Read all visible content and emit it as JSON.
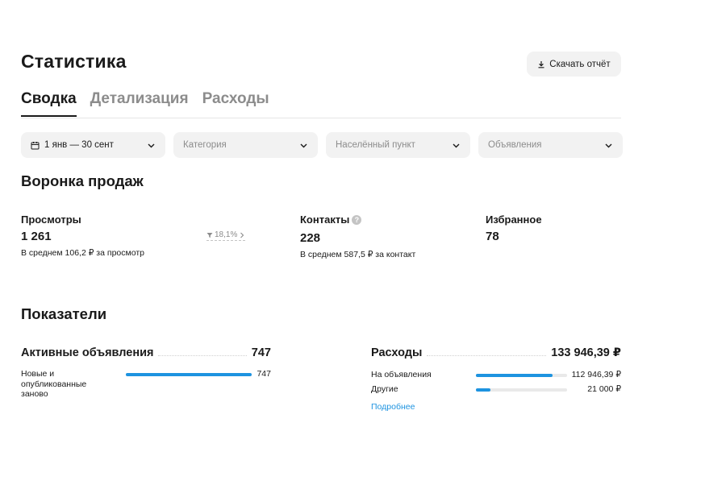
{
  "header": {
    "title": "Статистика",
    "download_label": "Скачать отчёт"
  },
  "tabs": [
    {
      "label": "Сводка",
      "active": true
    },
    {
      "label": "Детализация",
      "active": false
    },
    {
      "label": "Расходы",
      "active": false
    }
  ],
  "filters": {
    "date": "1 янв — 30 сент",
    "category": "Категория",
    "location": "Населённый пункт",
    "ads": "Объявления"
  },
  "funnel": {
    "title": "Воронка продаж",
    "views": {
      "label": "Просмотры",
      "value": "1 261",
      "sub": "В среднем 106,2 ₽ за просмотр"
    },
    "conversion": "18,1%",
    "contacts": {
      "label": "Контакты",
      "help": "?",
      "value": "228",
      "sub": "В среднем 587,5 ₽ за контакт"
    },
    "favorites": {
      "label": "Избранное",
      "value": "78"
    }
  },
  "indicators": {
    "title": "Показатели",
    "active": {
      "name": "Активные объявления",
      "total": "747",
      "rows": [
        {
          "label": "Новые и опубликованные заново",
          "value": "747",
          "fraction": 1.0
        }
      ]
    },
    "expenses": {
      "name": "Расходы",
      "total": "133 946,39 ₽",
      "rows": [
        {
          "label": "На объявления",
          "value": "112 946,39 ₽",
          "fraction": 0.843
        },
        {
          "label": "Другие",
          "value": "21 000 ₽",
          "fraction": 0.157
        }
      ],
      "more_label": "Подробнее"
    }
  },
  "colors": {
    "accent": "#1d93e0",
    "bar_track": "#e9e9e9",
    "muted": "#8c8c8c"
  }
}
